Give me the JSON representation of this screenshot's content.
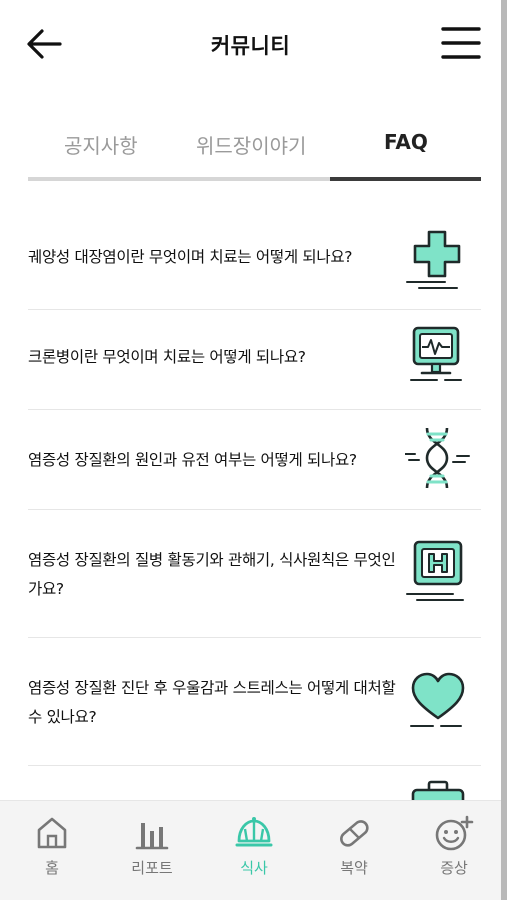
{
  "header": {
    "title": "커뮤니티",
    "back_icon": "arrow-left-icon",
    "menu_icon": "hamburger-menu-icon"
  },
  "tabs": [
    {
      "label": "공지사항",
      "active": false
    },
    {
      "label": "위드장이야기",
      "active": false
    },
    {
      "label": "FAQ",
      "active": true
    }
  ],
  "faq": [
    {
      "question": "궤양성 대장염이란 무엇이며 치료는 어떻게 되나요?",
      "icon": "medical-cross-icon"
    },
    {
      "question": "크론병이란 무엇이며 치료는 어떻게 되나요?",
      "icon": "heart-monitor-icon"
    },
    {
      "question": "염증성 장질환의 원인과 유전 여부는 어떻게 되나요?",
      "icon": "dna-icon"
    },
    {
      "question": "염증성 장질환의 질병 활동기와 관해기, 식사원칙은 무엇인가요?",
      "icon": "hospital-sign-icon"
    },
    {
      "question": "염증성 장질환 진단 후 우울감과 스트레스는 어떻게 대처할 수 있나요?",
      "icon": "heart-icon"
    },
    {
      "question": "",
      "icon": "medical-kit-icon"
    }
  ],
  "bottom_nav": [
    {
      "label": "홈",
      "icon": "home-icon",
      "active": false
    },
    {
      "label": "리포트",
      "icon": "bar-chart-icon",
      "active": false
    },
    {
      "label": "식사",
      "icon": "meal-dome-icon",
      "active": true
    },
    {
      "label": "복약",
      "icon": "pill-icon",
      "active": false
    },
    {
      "label": "증상",
      "icon": "smiley-plus-icon",
      "active": false
    }
  ],
  "colors": {
    "accent": "#3ac7a8",
    "icon_fill": "#7fe3c8",
    "outline": "#1f2a2a",
    "inactive": "#9a9a9a"
  }
}
